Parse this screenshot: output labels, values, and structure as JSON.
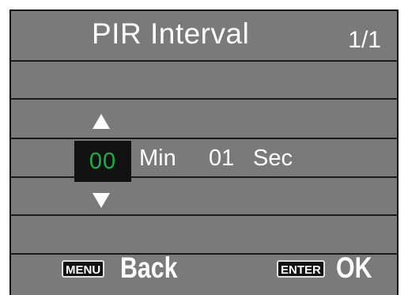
{
  "header": {
    "title": "PIR Interval",
    "page_indicator": "1/1"
  },
  "setting": {
    "minutes_value": "00",
    "minutes_unit": "Min",
    "seconds_value": "01",
    "seconds_unit": "Sec"
  },
  "footer": {
    "menu_key": "MENU",
    "back_label": "Back",
    "enter_key": "ENTER",
    "ok_label": "OK"
  },
  "colors": {
    "background": "#7a7a7a",
    "selected_value": "#17b048"
  }
}
